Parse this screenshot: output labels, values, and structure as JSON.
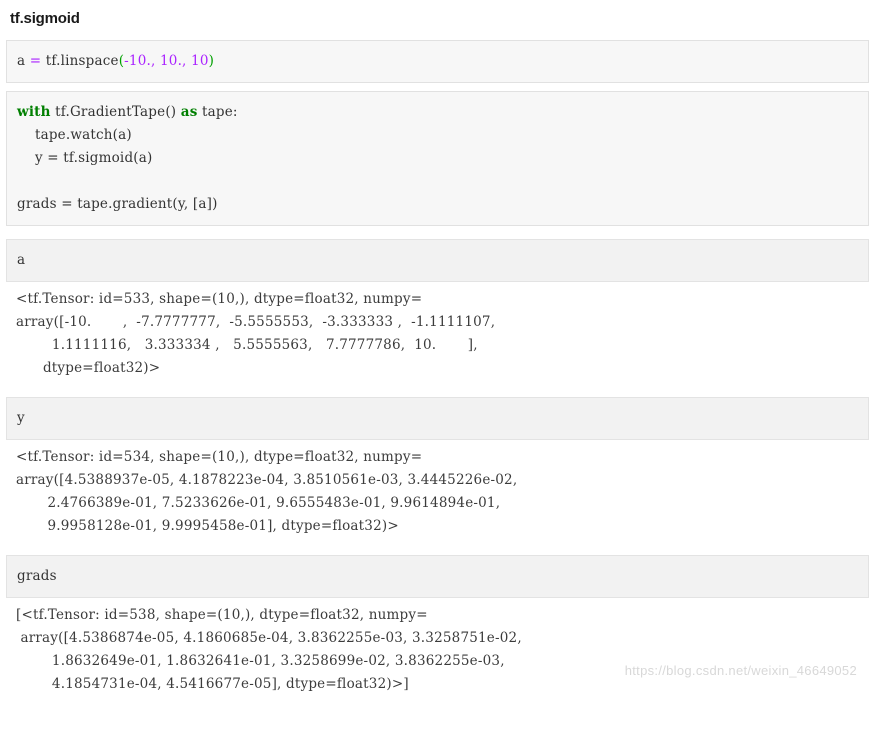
{
  "title": "tf.sigmoid",
  "watermark": "https://blog.csdn.net/weixin_46649052",
  "cells": {
    "input_linspace": {
      "var": "a",
      "eq": "=",
      "fn": "tf.linspace",
      "open": "(",
      "args": "-10., 10., 10",
      "close": ")",
      "full_text": "a = tf.linspace(-10., 10., 10)"
    },
    "input_tape": {
      "kw_with": "with",
      "tape_call": "tf.GradientTape()",
      "kw_as": "as",
      "tape_name": "tape:",
      "line2": "    tape.watch(a)",
      "line3": "    y = tf.sigmoid(a)",
      "line5": "grads = tape.gradient(y, [a])",
      "full_text": "with tf.GradientTape() as tape:\n    tape.watch(a)\n    y = tf.sigmoid(a)\n\ngrads = tape.gradient(y, [a])"
    },
    "label_a": "a",
    "label_y": "y",
    "label_grads": "grads"
  },
  "outputs": {
    "a": {
      "header": "<tf.Tensor: id=533, shape=(10,), dtype=float32, numpy=",
      "lines": [
        "array([-10.       ,  -7.7777777,  -5.5555553,  -3.333333 ,  -1.1111107,",
        "        1.1111116,   3.333334 ,   5.5555563,   7.7777786,  10.       ],",
        "      dtype=float32)>"
      ],
      "tensor_id": "533",
      "shape": "(10,)",
      "dtype": "float32",
      "values": [
        -10.0,
        -7.7777777,
        -5.5555553,
        -3.333333,
        -1.1111107,
        1.1111116,
        3.333334,
        5.5555563,
        7.7777786,
        10.0
      ]
    },
    "y": {
      "header": "<tf.Tensor: id=534, shape=(10,), dtype=float32, numpy=",
      "lines": [
        "array([4.5388937e-05, 4.1878223e-04, 3.8510561e-03, 3.4445226e-02,",
        "       2.4766389e-01, 7.5233626e-01, 9.6555483e-01, 9.9614894e-01,",
        "       9.9958128e-01, 9.9995458e-01], dtype=float32)>"
      ],
      "tensor_id": "534",
      "shape": "(10,)",
      "dtype": "float32",
      "values": [
        4.5388937e-05,
        0.00041878223,
        0.0038510561,
        0.034445226,
        0.24766389,
        0.75233626,
        0.96555483,
        0.99614894,
        0.99958128,
        0.99995458
      ]
    },
    "grads": {
      "header": "[<tf.Tensor: id=538, shape=(10,), dtype=float32, numpy=",
      "lines": [
        " array([4.5386874e-05, 4.1860685e-04, 3.8362255e-03, 3.3258751e-02,",
        "        1.8632649e-01, 1.8632641e-01, 3.3258699e-02, 3.8362255e-03,",
        "        4.1854731e-04, 4.5416677e-05], dtype=float32)>]"
      ],
      "tensor_id": "538",
      "shape": "(10,)",
      "dtype": "float32",
      "values": [
        4.5386874e-05,
        0.00041860685,
        0.0038362255,
        0.033258751,
        0.18632649,
        0.18632641,
        0.033258699,
        0.0038362255,
        0.00041854731,
        4.5416677e-05
      ]
    }
  }
}
